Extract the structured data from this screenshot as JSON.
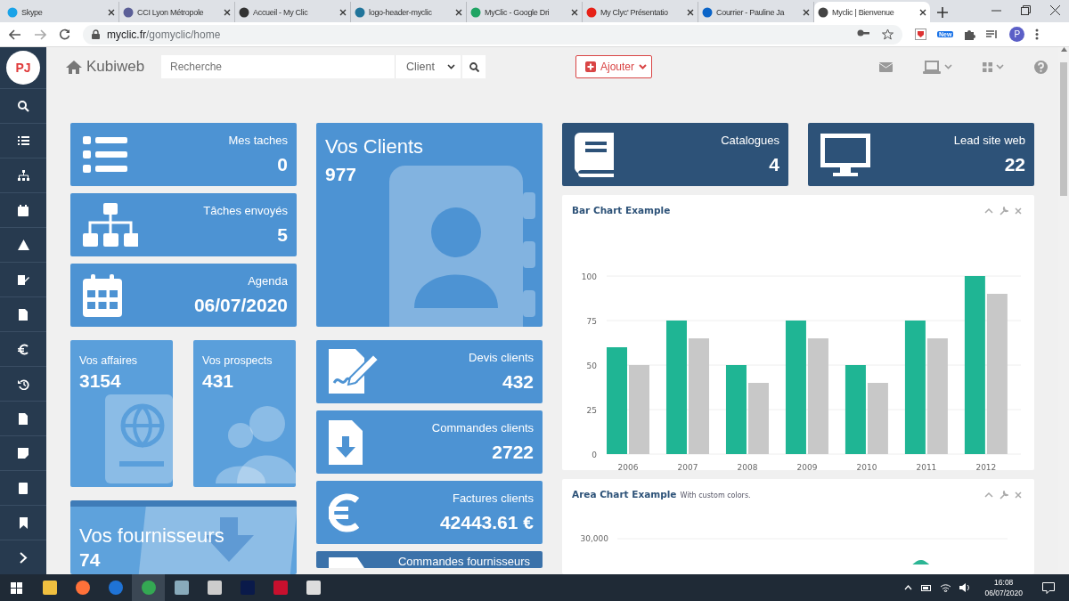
{
  "browser": {
    "tabs": [
      {
        "title": "Skype",
        "selected": false
      },
      {
        "title": "CCI Lyon Métropole",
        "selected": false
      },
      {
        "title": "Accueil - My Clic",
        "selected": false
      },
      {
        "title": "logo-header-myclic",
        "selected": false
      },
      {
        "title": "MyClic - Google Dri",
        "selected": false
      },
      {
        "title": "My Clyc' Présentatio",
        "selected": false
      },
      {
        "title": "Courrier - Pauline Ja",
        "selected": false
      },
      {
        "title": "Myclic | Bienvenue",
        "selected": true
      }
    ],
    "url_host": "myclic.fr",
    "url_path": "/gomyclic/home",
    "extension_badge": "New",
    "profile": "P"
  },
  "app": {
    "avatar": "PJ",
    "brand": "Kubiweb",
    "search": {
      "placeholder": "Recherche"
    },
    "scope": "Client",
    "add_button": "Ajouter"
  },
  "column_1": [
    {
      "kind": "icon",
      "label": "Mes taches",
      "value": "0",
      "color": "#4d93d3"
    },
    {
      "kind": "icon",
      "label": "Tâches envoyés",
      "value": "5",
      "color": "#4d93d3"
    },
    {
      "kind": "icon",
      "label": "Agenda",
      "value": "06/07/2020",
      "color": "#4d93d3"
    },
    {
      "kind": "pair",
      "tiles": [
        {
          "kind": "compact",
          "label": "Vos affaires",
          "value": "3154",
          "color": "#5a9fdb"
        },
        {
          "kind": "compact",
          "label": "Vos prospects",
          "value": "431",
          "color": "#5a9fdb"
        }
      ]
    },
    {
      "kind": "banner",
      "label": "Vos fournisseurs",
      "value": "74",
      "color": "#5ea2dc"
    }
  ],
  "column_2": [
    {
      "kind": "feature",
      "label": "Vos Clients",
      "value": "977",
      "color": "#4d93d3"
    },
    {
      "kind": "icon",
      "label": "Devis clients",
      "value": "432",
      "color": "#4d93d3"
    },
    {
      "kind": "icon",
      "label": "Commandes clients",
      "value": "2722",
      "color": "#4d93d3"
    },
    {
      "kind": "icon",
      "label": "Factures clients",
      "value": "42443.61 €",
      "color": "#4d93d3"
    },
    {
      "kind": "partial",
      "label": "Commandes fournisseurs",
      "color": "#3b72aa"
    }
  ],
  "top_right": [
    {
      "kind": "icon",
      "label": "Catalogues",
      "value": "4",
      "color": "#2d5278"
    },
    {
      "kind": "icon",
      "label": "Lead site web",
      "value": "22",
      "color": "#2d5278"
    }
  ],
  "bar_chart": {
    "title": "Bar Chart Example",
    "chart_data": {
      "type": "bar",
      "categories": [
        "2006",
        "2007",
        "2008",
        "2009",
        "2010",
        "2011",
        "2012"
      ],
      "series": [
        {
          "color": "#1fb594",
          "values": [
            60,
            75,
            50,
            75,
            50,
            75,
            100
          ]
        },
        {
          "color": "#c8c8c8",
          "values": [
            50,
            65,
            40,
            65,
            40,
            65,
            90
          ]
        }
      ],
      "grid": true,
      "ylim": [
        0,
        100
      ],
      "yticks": [
        0,
        25,
        50,
        75,
        100
      ]
    }
  },
  "area_chart": {
    "title": "Area Chart Example",
    "subtitle": "With custom colors.",
    "tick_label": "30,000"
  },
  "taskbar": {
    "time": "16:08",
    "date": "06/07/2020"
  }
}
